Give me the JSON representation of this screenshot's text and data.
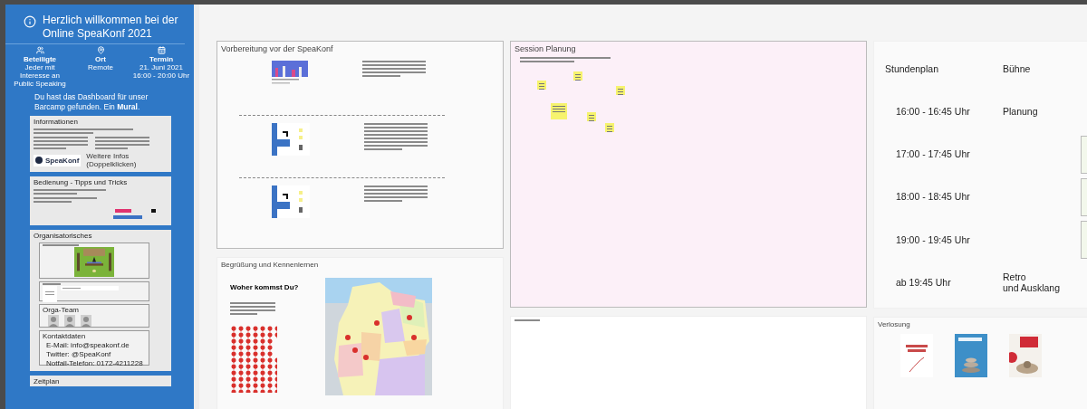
{
  "sidebar": {
    "title": "Herzlich willkommen bei der Online SpeaKonf  2021",
    "facts": [
      {
        "kind": "people",
        "label": "Beteiligte",
        "value": "Jeder mit Interesse an Public Speaking"
      },
      {
        "kind": "place",
        "label": "Ort",
        "value": "Remote"
      },
      {
        "kind": "date",
        "label": "Termin",
        "value": "21. Juni 2021 16:00 - 20:00 Uhr"
      }
    ],
    "intro": "Du hast das Dashboard für unser Barcamp gefunden. Ein **Mural**.",
    "info_card": {
      "title": "Informationen",
      "logo": "SpeaKonf",
      "link": "Weitere Infos (Doppelklicken)"
    },
    "tips_card": {
      "title": "Bedienung - Tipps und Tricks"
    },
    "orga_card": {
      "title": "Organisatorisches",
      "team_title": "Orga-Team",
      "contact_title": "Kontaktdaten",
      "contact_lines": [
        "E-Mail: info@speakonf.de",
        "Twitter: @SpeaKonf",
        "Notfall-Telefon: 0172-4211228"
      ]
    },
    "schedule_card": {
      "title": "Zeitplan"
    }
  },
  "preparation": {
    "title": "Vorbereitung vor der SpeaKonf",
    "steps": [
      {
        "kind": "video"
      },
      {
        "kind": "screenshot"
      },
      {
        "kind": "screenshot"
      }
    ]
  },
  "welcome": {
    "title": "Begrüßung und Kennenlernen",
    "question": "Woher kommst Du?"
  },
  "session": {
    "title": "Session Planung"
  },
  "schedule": {
    "title": "Stundenplan",
    "stage": "Bühne",
    "slots": [
      {
        "kind": "fixed",
        "time": "16:00 - 16:45 Uhr",
        "session": "Planung"
      },
      {
        "kind": "open",
        "time": "17:00 - 17:45 Uhr"
      },
      {
        "kind": "open",
        "time": "18:00 - 18:45 Uhr"
      },
      {
        "kind": "open",
        "time": "19:00 - 19:45 Uhr"
      },
      {
        "kind": "fixed",
        "time": "ab 19:45 Uhr",
        "session": "Retro\nund Ausklang"
      }
    ]
  },
  "raffle": {
    "title": "Verlosung"
  }
}
